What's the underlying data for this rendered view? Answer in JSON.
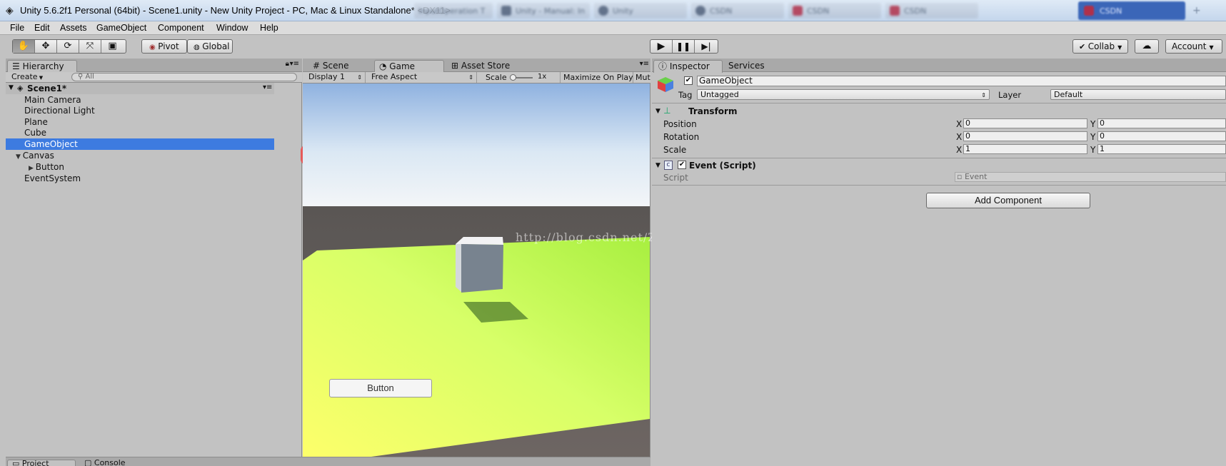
{
  "window": {
    "title": "Unity 5.6.2f1 Personal (64bit) - Scene1.unity - New Unity Project - PC, Mac & Linux Standalone* <DX11>",
    "background_tabs": [
      "InputOperation T",
      "Unity - Manual: In",
      "Unity",
      "CSDN",
      "CSDN",
      "CSDN"
    ],
    "active_tab": "CSDN"
  },
  "menu": [
    "File",
    "Edit",
    "Assets",
    "GameObject",
    "Component",
    "Window",
    "Help"
  ],
  "toolbar": {
    "tools": [
      "hand-tool",
      "move-tool",
      "rotate-tool",
      "scale-tool",
      "rect-tool"
    ],
    "pivot_label": "Pivot",
    "global_label": "Global",
    "collab_label": "Collab",
    "account_label": "Account"
  },
  "hierarchy": {
    "tab_label": "Hierarchy",
    "create_label": "Create",
    "search_placeholder": "All",
    "scene_name": "Scene1*",
    "items": [
      "Main Camera",
      "Directional Light",
      "Plane",
      "Cube",
      "GameObject",
      "Canvas",
      "Button",
      "EventSystem"
    ],
    "selected_item": "GameObject"
  },
  "game_view": {
    "tabs": [
      "Scene",
      "Game",
      "Asset Store"
    ],
    "active_tab": "Game",
    "display_label": "Display 1",
    "aspect_label": "Free Aspect",
    "scale_label": "Scale",
    "scale_value": "1x",
    "maximize_label": "Maximize On Play",
    "mute_label": "Mute",
    "ui_button_label": "Button",
    "watermark": "http://blog.csdn.net/Zuozaoqi"
  },
  "inspector": {
    "tabs": [
      "Inspector",
      "Services"
    ],
    "object_name": "GameObject",
    "tag_label": "Tag",
    "tag_value": "Untagged",
    "layer_label": "Layer",
    "layer_value": "Default",
    "transform": {
      "title": "Transform",
      "rows": [
        {
          "label": "Position",
          "x": "0",
          "y": "0"
        },
        {
          "label": "Rotation",
          "x": "0",
          "y": "0"
        },
        {
          "label": "Scale",
          "x": "1",
          "y": "1"
        }
      ],
      "x_axis": "X",
      "y_axis": "Y"
    },
    "script_component": {
      "title": "Event (Script)",
      "script_label": "Script",
      "script_value": "Event"
    },
    "add_component_label": "Add Component"
  },
  "bottom": {
    "tabs": [
      "Project",
      "Console"
    ]
  },
  "colors": {
    "selection": "#3d7be0",
    "panel_bg": "#c2c2c2",
    "ground": "#c8ff6a",
    "sky_top": "#8fb2e0"
  }
}
